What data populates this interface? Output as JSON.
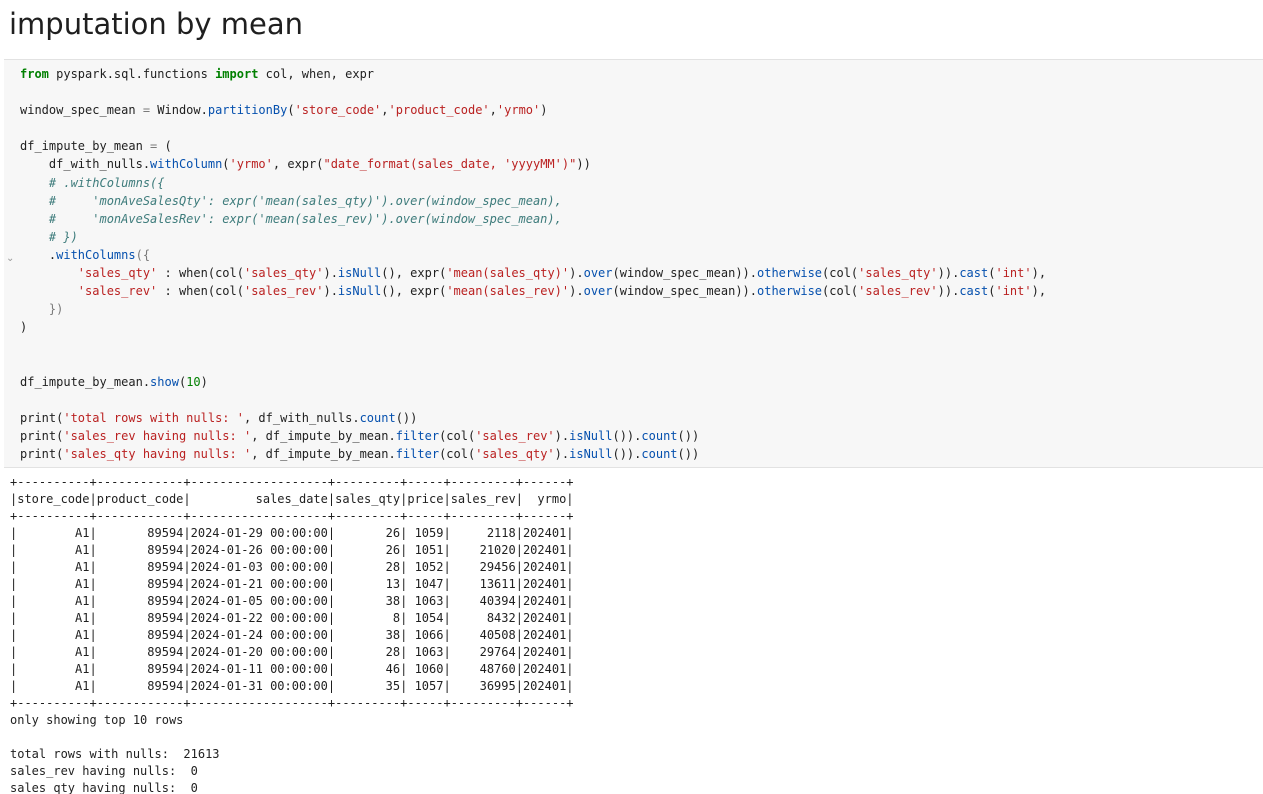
{
  "heading": "imputation by mean",
  "code_lines": [
    [
      {
        "t": "from",
        "c": "kw"
      },
      {
        "t": " pyspark.sql.functions "
      },
      {
        "t": "import",
        "c": "kw"
      },
      {
        "t": " col, when, expr"
      }
    ],
    [],
    [
      {
        "t": "window_spec_mean "
      },
      {
        "t": "=",
        "c": "op"
      },
      {
        "t": " Window."
      },
      {
        "t": "partitionBy",
        "c": "fn"
      },
      {
        "t": "("
      },
      {
        "t": "'store_code'",
        "c": "str"
      },
      {
        "t": ","
      },
      {
        "t": "'product_code'",
        "c": "str"
      },
      {
        "t": ","
      },
      {
        "t": "'yrmo'",
        "c": "str"
      },
      {
        "t": ")"
      }
    ],
    [],
    [
      {
        "t": "df_impute_by_mean "
      },
      {
        "t": "=",
        "c": "op"
      },
      {
        "t": " ("
      }
    ],
    [
      {
        "t": "    df_with_nulls."
      },
      {
        "t": "withColumn",
        "c": "fn"
      },
      {
        "t": "("
      },
      {
        "t": "'yrmo'",
        "c": "str"
      },
      {
        "t": ", expr("
      },
      {
        "t": "\"date_format(sales_date, 'yyyyMM')\"",
        "c": "str"
      },
      {
        "t": "))"
      }
    ],
    [
      {
        "t": "    # .withColumns({",
        "c": "cmt"
      }
    ],
    [
      {
        "t": "    #     'monAveSalesQty': expr('mean(sales_qty)').over(window_spec_mean),",
        "c": "cmt"
      }
    ],
    [
      {
        "t": "    #     'monAveSalesRev': expr('mean(sales_rev)').over(window_spec_mean),",
        "c": "cmt"
      }
    ],
    [
      {
        "t": "    # })",
        "c": "cmt"
      }
    ],
    [
      {
        "t": "    ."
      },
      {
        "t": "withColumns",
        "c": "fn"
      },
      {
        "t": "({",
        "c": "op"
      }
    ],
    [
      {
        "t": "        "
      },
      {
        "t": "'sales_qty'",
        "c": "str"
      },
      {
        "t": " : when(col("
      },
      {
        "t": "'sales_qty'",
        "c": "str"
      },
      {
        "t": ")."
      },
      {
        "t": "isNull",
        "c": "fn"
      },
      {
        "t": "(), expr("
      },
      {
        "t": "'mean(sales_qty)'",
        "c": "str"
      },
      {
        "t": ")."
      },
      {
        "t": "over",
        "c": "fn"
      },
      {
        "t": "(window_spec_mean))."
      },
      {
        "t": "otherwise",
        "c": "fn"
      },
      {
        "t": "(col("
      },
      {
        "t": "'sales_qty'",
        "c": "str"
      },
      {
        "t": "))."
      },
      {
        "t": "cast",
        "c": "fn"
      },
      {
        "t": "("
      },
      {
        "t": "'int'",
        "c": "str"
      },
      {
        "t": "),"
      }
    ],
    [
      {
        "t": "        "
      },
      {
        "t": "'sales_rev'",
        "c": "str"
      },
      {
        "t": " : when(col("
      },
      {
        "t": "'sales_rev'",
        "c": "str"
      },
      {
        "t": ")."
      },
      {
        "t": "isNull",
        "c": "fn"
      },
      {
        "t": "(), expr("
      },
      {
        "t": "'mean(sales_rev)'",
        "c": "str"
      },
      {
        "t": ")."
      },
      {
        "t": "over",
        "c": "fn"
      },
      {
        "t": "(window_spec_mean))."
      },
      {
        "t": "otherwise",
        "c": "fn"
      },
      {
        "t": "(col("
      },
      {
        "t": "'sales_rev'",
        "c": "str"
      },
      {
        "t": "))."
      },
      {
        "t": "cast",
        "c": "fn"
      },
      {
        "t": "("
      },
      {
        "t": "'int'",
        "c": "str"
      },
      {
        "t": "),"
      }
    ],
    [
      {
        "t": "    "
      },
      {
        "t": "})",
        "c": "op"
      }
    ],
    [
      {
        "t": ")"
      }
    ],
    [],
    [],
    [
      {
        "t": "df_impute_by_mean."
      },
      {
        "t": "show",
        "c": "fn"
      },
      {
        "t": "("
      },
      {
        "t": "10",
        "c": "num"
      },
      {
        "t": ")"
      }
    ],
    [],
    [
      {
        "t": "print("
      },
      {
        "t": "'total rows with nulls: '",
        "c": "str"
      },
      {
        "t": ", df_with_nulls."
      },
      {
        "t": "count",
        "c": "fn"
      },
      {
        "t": "())"
      }
    ],
    [
      {
        "t": "print("
      },
      {
        "t": "'sales_rev having nulls: '",
        "c": "str"
      },
      {
        "t": ", df_impute_by_mean."
      },
      {
        "t": "filter",
        "c": "fn"
      },
      {
        "t": "(col("
      },
      {
        "t": "'sales_rev'",
        "c": "str"
      },
      {
        "t": ")."
      },
      {
        "t": "isNull",
        "c": "fn"
      },
      {
        "t": "())."
      },
      {
        "t": "count",
        "c": "fn"
      },
      {
        "t": "())"
      }
    ],
    [
      {
        "t": "print("
      },
      {
        "t": "'sales_qty having nulls: '",
        "c": "str"
      },
      {
        "t": ", df_impute_by_mean."
      },
      {
        "t": "filter",
        "c": "fn"
      },
      {
        "t": "(col("
      },
      {
        "t": "'sales_qty'",
        "c": "str"
      },
      {
        "t": ")."
      },
      {
        "t": "isNull",
        "c": "fn"
      },
      {
        "t": "())."
      },
      {
        "t": "count",
        "c": "fn"
      },
      {
        "t": "())"
      }
    ]
  ],
  "fold_marker": "⌄",
  "output_lines": [
    "+----------+------------+-------------------+---------+-----+---------+------+",
    "|store_code|product_code|         sales_date|sales_qty|price|sales_rev|  yrmo|",
    "+----------+------------+-------------------+---------+-----+---------+------+",
    "|        A1|       89594|2024-01-29 00:00:00|       26| 1059|     2118|202401|",
    "|        A1|       89594|2024-01-26 00:00:00|       26| 1051|    21020|202401|",
    "|        A1|       89594|2024-01-03 00:00:00|       28| 1052|    29456|202401|",
    "|        A1|       89594|2024-01-21 00:00:00|       13| 1047|    13611|202401|",
    "|        A1|       89594|2024-01-05 00:00:00|       38| 1063|    40394|202401|",
    "|        A1|       89594|2024-01-22 00:00:00|        8| 1054|     8432|202401|",
    "|        A1|       89594|2024-01-24 00:00:00|       38| 1066|    40508|202401|",
    "|        A1|       89594|2024-01-20 00:00:00|       28| 1063|    29764|202401|",
    "|        A1|       89594|2024-01-11 00:00:00|       46| 1060|    48760|202401|",
    "|        A1|       89594|2024-01-31 00:00:00|       35| 1057|    36995|202401|",
    "+----------+------------+-------------------+---------+-----+---------+------+",
    "only showing top 10 rows",
    "",
    "total rows with nulls:  21613",
    "sales_rev having nulls:  0",
    "sales_qty having nulls:  0"
  ]
}
